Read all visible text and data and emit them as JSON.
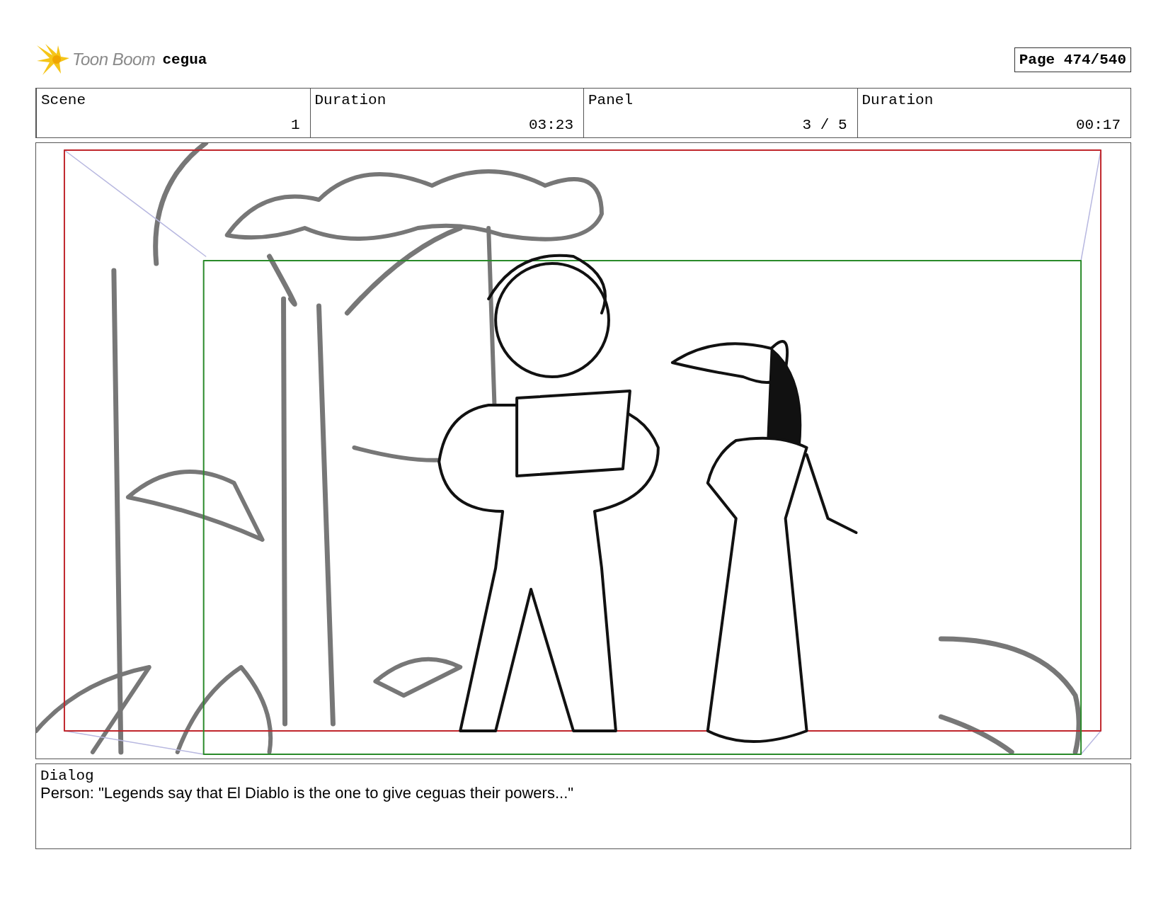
{
  "header": {
    "logo_text": "Toon Boom",
    "project": "cegua",
    "page": "Page 474/540"
  },
  "info": [
    {
      "label": "Scene",
      "value": "1"
    },
    {
      "label": "Duration",
      "value": "03:23"
    },
    {
      "label": "Panel",
      "value": "3 / 5"
    },
    {
      "label": "Duration",
      "value": "00:17"
    }
  ],
  "panel": {
    "kind": "sketch"
  },
  "dialog": {
    "label": "Dialog",
    "text": "Person: \"Legends say that El Diablo is the one to give ceguas their powers...\""
  }
}
